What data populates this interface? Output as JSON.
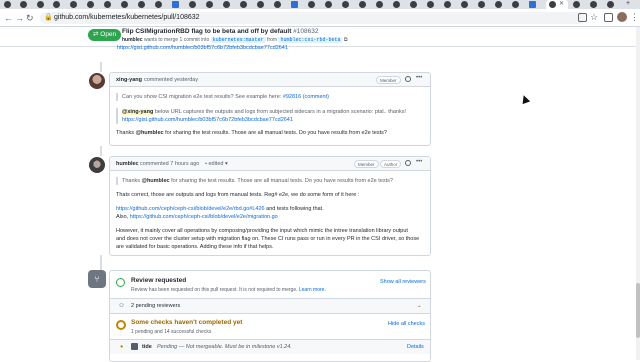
{
  "browser": {
    "url": "github.com/kubernetes/kubernetes/pull/108632"
  },
  "pr": {
    "state": "Open",
    "title": "Flip CSIMigrationRBD flag to be beta and off by default",
    "number": "#108632",
    "author": "humblec",
    "merge_text_1": "wants to merge 1 commit into",
    "base_branch": "kubernetes:master",
    "merge_text_2": "from",
    "head_branch": "humblec:csi-rbd-beta"
  },
  "top_link": "https://gist.github.com/humblec/b03bf57c6b72bfeb3bcdcbae77cd2641",
  "comment1": {
    "author": "xing-yang",
    "time": "commented yesterday",
    "badge": "Member",
    "quote_line1_prefix": "Can you show CSI migration e2e test results? See example here: ",
    "quote_line1_link": "#92816 (comment)",
    "quote_mention": "@xing-yang",
    "quote_line2": " below URL captures the outputs and logs from subjected sidecars in a migration scenario: ptal.. thanks!",
    "quote_link": "https://gist.github.com/humblec/b03bf57c6b72bfeb3bcdcbae77cd2641",
    "body_prefix": "Thanks ",
    "body_mention": "@humblec",
    "body_rest": " for sharing the test results. Those are all manual tests. Do you have results from e2e tests?"
  },
  "comment2": {
    "author": "humblec",
    "time": "commented 7 hours ago",
    "edited": "• edited ▾",
    "badge_member": "Member",
    "badge_author": "Author",
    "quote_prefix": "Thanks ",
    "quote_mention": "@humblec",
    "quote_rest": " for sharing the test results. Those are all manual tests. Do you have results from e2e tests?",
    "p1": "Thats correct, those are outputs and logs from manual tests. Reg# e2e, we do some form of it here :",
    "link1": "https://github.com/ceph/ceph-csi/blob/devel/e2e/rbd.go#L426",
    "link1_suffix": " and tests following that.",
    "also": "Also, ",
    "link2": "https://github.com/ceph/ceph-csi/blob/devel/e2e/migration.go",
    "p2_line1": "However, it mainly cover all operations by composing/providing the input which mimic the intree translation library output",
    "p2_line2": "and does not cover the cluster setup with migration flag on. These CI runs pass or run in every PR in the CSI driver, so those",
    "p2_line3": "are validated for basic operations. Adding these info if that helps."
  },
  "review": {
    "title": "Review requested",
    "show_all": "Show all reviewers",
    "desc_prefix": "Review has been requested on this pull request. It is not required to merge. ",
    "learn_more": "Learn more.",
    "pending_reviewers": "2 pending reviewers",
    "checks_title": "Some checks haven't completed yet",
    "checks_sub": "1 pending and 14 successful checks",
    "hide_all": "Hide all checks",
    "check_name": "tide",
    "check_status": "Pending — Not mergeable. Must be in milestone v1.24.",
    "details": "Details"
  }
}
